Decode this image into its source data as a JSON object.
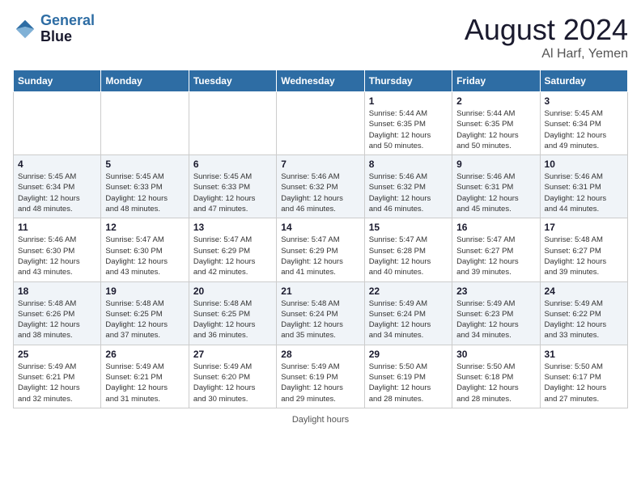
{
  "header": {
    "logo_line1": "General",
    "logo_line2": "Blue",
    "title": "August 2024",
    "subtitle": "Al Harf, Yemen"
  },
  "days_of_week": [
    "Sunday",
    "Monday",
    "Tuesday",
    "Wednesday",
    "Thursday",
    "Friday",
    "Saturday"
  ],
  "weeks": [
    [
      {
        "day": "",
        "info": ""
      },
      {
        "day": "",
        "info": ""
      },
      {
        "day": "",
        "info": ""
      },
      {
        "day": "",
        "info": ""
      },
      {
        "day": "1",
        "info": "Sunrise: 5:44 AM\nSunset: 6:35 PM\nDaylight: 12 hours\nand 50 minutes."
      },
      {
        "day": "2",
        "info": "Sunrise: 5:44 AM\nSunset: 6:35 PM\nDaylight: 12 hours\nand 50 minutes."
      },
      {
        "day": "3",
        "info": "Sunrise: 5:45 AM\nSunset: 6:34 PM\nDaylight: 12 hours\nand 49 minutes."
      }
    ],
    [
      {
        "day": "4",
        "info": "Sunrise: 5:45 AM\nSunset: 6:34 PM\nDaylight: 12 hours\nand 48 minutes."
      },
      {
        "day": "5",
        "info": "Sunrise: 5:45 AM\nSunset: 6:33 PM\nDaylight: 12 hours\nand 48 minutes."
      },
      {
        "day": "6",
        "info": "Sunrise: 5:45 AM\nSunset: 6:33 PM\nDaylight: 12 hours\nand 47 minutes."
      },
      {
        "day": "7",
        "info": "Sunrise: 5:46 AM\nSunset: 6:32 PM\nDaylight: 12 hours\nand 46 minutes."
      },
      {
        "day": "8",
        "info": "Sunrise: 5:46 AM\nSunset: 6:32 PM\nDaylight: 12 hours\nand 46 minutes."
      },
      {
        "day": "9",
        "info": "Sunrise: 5:46 AM\nSunset: 6:31 PM\nDaylight: 12 hours\nand 45 minutes."
      },
      {
        "day": "10",
        "info": "Sunrise: 5:46 AM\nSunset: 6:31 PM\nDaylight: 12 hours\nand 44 minutes."
      }
    ],
    [
      {
        "day": "11",
        "info": "Sunrise: 5:46 AM\nSunset: 6:30 PM\nDaylight: 12 hours\nand 43 minutes."
      },
      {
        "day": "12",
        "info": "Sunrise: 5:47 AM\nSunset: 6:30 PM\nDaylight: 12 hours\nand 43 minutes."
      },
      {
        "day": "13",
        "info": "Sunrise: 5:47 AM\nSunset: 6:29 PM\nDaylight: 12 hours\nand 42 minutes."
      },
      {
        "day": "14",
        "info": "Sunrise: 5:47 AM\nSunset: 6:29 PM\nDaylight: 12 hours\nand 41 minutes."
      },
      {
        "day": "15",
        "info": "Sunrise: 5:47 AM\nSunset: 6:28 PM\nDaylight: 12 hours\nand 40 minutes."
      },
      {
        "day": "16",
        "info": "Sunrise: 5:47 AM\nSunset: 6:27 PM\nDaylight: 12 hours\nand 39 minutes."
      },
      {
        "day": "17",
        "info": "Sunrise: 5:48 AM\nSunset: 6:27 PM\nDaylight: 12 hours\nand 39 minutes."
      }
    ],
    [
      {
        "day": "18",
        "info": "Sunrise: 5:48 AM\nSunset: 6:26 PM\nDaylight: 12 hours\nand 38 minutes."
      },
      {
        "day": "19",
        "info": "Sunrise: 5:48 AM\nSunset: 6:25 PM\nDaylight: 12 hours\nand 37 minutes."
      },
      {
        "day": "20",
        "info": "Sunrise: 5:48 AM\nSunset: 6:25 PM\nDaylight: 12 hours\nand 36 minutes."
      },
      {
        "day": "21",
        "info": "Sunrise: 5:48 AM\nSunset: 6:24 PM\nDaylight: 12 hours\nand 35 minutes."
      },
      {
        "day": "22",
        "info": "Sunrise: 5:49 AM\nSunset: 6:24 PM\nDaylight: 12 hours\nand 34 minutes."
      },
      {
        "day": "23",
        "info": "Sunrise: 5:49 AM\nSunset: 6:23 PM\nDaylight: 12 hours\nand 34 minutes."
      },
      {
        "day": "24",
        "info": "Sunrise: 5:49 AM\nSunset: 6:22 PM\nDaylight: 12 hours\nand 33 minutes."
      }
    ],
    [
      {
        "day": "25",
        "info": "Sunrise: 5:49 AM\nSunset: 6:21 PM\nDaylight: 12 hours\nand 32 minutes."
      },
      {
        "day": "26",
        "info": "Sunrise: 5:49 AM\nSunset: 6:21 PM\nDaylight: 12 hours\nand 31 minutes."
      },
      {
        "day": "27",
        "info": "Sunrise: 5:49 AM\nSunset: 6:20 PM\nDaylight: 12 hours\nand 30 minutes."
      },
      {
        "day": "28",
        "info": "Sunrise: 5:49 AM\nSunset: 6:19 PM\nDaylight: 12 hours\nand 29 minutes."
      },
      {
        "day": "29",
        "info": "Sunrise: 5:50 AM\nSunset: 6:19 PM\nDaylight: 12 hours\nand 28 minutes."
      },
      {
        "day": "30",
        "info": "Sunrise: 5:50 AM\nSunset: 6:18 PM\nDaylight: 12 hours\nand 28 minutes."
      },
      {
        "day": "31",
        "info": "Sunrise: 5:50 AM\nSunset: 6:17 PM\nDaylight: 12 hours\nand 27 minutes."
      }
    ]
  ],
  "footer": {
    "text": "Daylight hours"
  }
}
